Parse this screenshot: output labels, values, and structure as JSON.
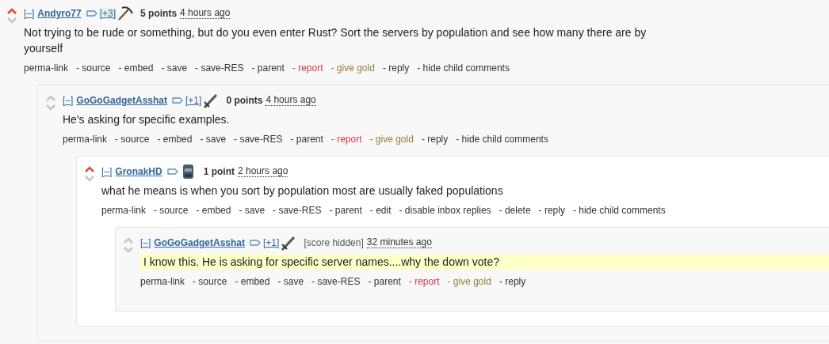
{
  "comments": [
    {
      "collapse": "[–]",
      "author": "Andyro77",
      "vote_weight": "[+3]",
      "vote_weight_highlighted": true,
      "flair": {
        "kind": "pickaxe"
      },
      "score": "5 points",
      "score_hidden": false,
      "time": "4 hours ago",
      "upvoted": true,
      "highlighted": false,
      "body": "Not trying to be rude or something, but do you even enter Rust? Sort the servers by population and see how many there are by yourself",
      "links": [
        {
          "label": "perma-link",
          "kind": "normal"
        },
        {
          "label": "- source",
          "kind": "normal"
        },
        {
          "label": "- embed",
          "kind": "normal"
        },
        {
          "label": "- save",
          "kind": "normal"
        },
        {
          "label": "- save-RES",
          "kind": "normal"
        },
        {
          "label": "- parent",
          "kind": "normal"
        },
        {
          "label": "- report",
          "kind": "report"
        },
        {
          "label": "- give gold",
          "kind": "gold"
        },
        {
          "label": "- reply",
          "kind": "normal"
        },
        {
          "label": "- hide child comments",
          "kind": "normal"
        }
      ],
      "children": [
        {
          "collapse": "[–]",
          "author": "GoGoGadgetAsshat",
          "vote_weight": "[+1]",
          "vote_weight_highlighted": false,
          "flair": {
            "kind": "sword"
          },
          "score": "0 points",
          "score_hidden": false,
          "time": "4 hours ago",
          "upvoted": false,
          "highlighted": false,
          "body": "He's asking for specific examples.",
          "links": [
            {
              "label": "perma-link",
              "kind": "normal"
            },
            {
              "label": "- source",
              "kind": "normal"
            },
            {
              "label": "- embed",
              "kind": "normal"
            },
            {
              "label": "- save",
              "kind": "normal"
            },
            {
              "label": "- save-RES",
              "kind": "normal"
            },
            {
              "label": "- parent",
              "kind": "normal"
            },
            {
              "label": "- report",
              "kind": "report"
            },
            {
              "label": "- give gold",
              "kind": "gold"
            },
            {
              "label": "- reply",
              "kind": "normal"
            },
            {
              "label": "- hide child comments",
              "kind": "normal"
            }
          ],
          "children": [
            {
              "collapse": "[–]",
              "author": "GronakHD",
              "flair": {
                "kind": "robot"
              },
              "score": "1 point",
              "score_hidden": false,
              "time": "2 hours ago",
              "upvoted": true,
              "highlighted": false,
              "body": "what he means is when you sort by population most are usually faked populations",
              "links": [
                {
                  "label": "perma-link",
                  "kind": "normal"
                },
                {
                  "label": "- source",
                  "kind": "normal"
                },
                {
                  "label": "- embed",
                  "kind": "normal"
                },
                {
                  "label": "- save",
                  "kind": "normal"
                },
                {
                  "label": "- save-RES",
                  "kind": "normal"
                },
                {
                  "label": "- parent",
                  "kind": "normal"
                },
                {
                  "label": "- edit",
                  "kind": "normal"
                },
                {
                  "label": "- disable inbox replies",
                  "kind": "normal"
                },
                {
                  "label": "- delete",
                  "kind": "normal"
                },
                {
                  "label": "- reply",
                  "kind": "normal"
                },
                {
                  "label": "- hide child comments",
                  "kind": "normal"
                }
              ],
              "children": [
                {
                  "collapse": "[–]",
                  "author": "GoGoGadgetAsshat",
                  "vote_weight": "[+1]",
                  "vote_weight_highlighted": false,
                  "flair": {
                    "kind": "sword"
                  },
                  "score": "[score hidden]",
                  "score_hidden": true,
                  "time": "32 minutes ago",
                  "upvoted": false,
                  "highlighted": true,
                  "body": "I know this. He is asking for specific server names....why the down vote?",
                  "links": [
                    {
                      "label": "perma-link",
                      "kind": "normal"
                    },
                    {
                      "label": "- source",
                      "kind": "normal"
                    },
                    {
                      "label": "- embed",
                      "kind": "normal"
                    },
                    {
                      "label": "- save",
                      "kind": "normal"
                    },
                    {
                      "label": "- save-RES",
                      "kind": "normal"
                    },
                    {
                      "label": "- parent",
                      "kind": "normal"
                    },
                    {
                      "label": "- report",
                      "kind": "report"
                    },
                    {
                      "label": "- give gold",
                      "kind": "gold"
                    },
                    {
                      "label": "- reply",
                      "kind": "normal"
                    }
                  ]
                }
              ]
            }
          ]
        }
      ]
    }
  ]
}
